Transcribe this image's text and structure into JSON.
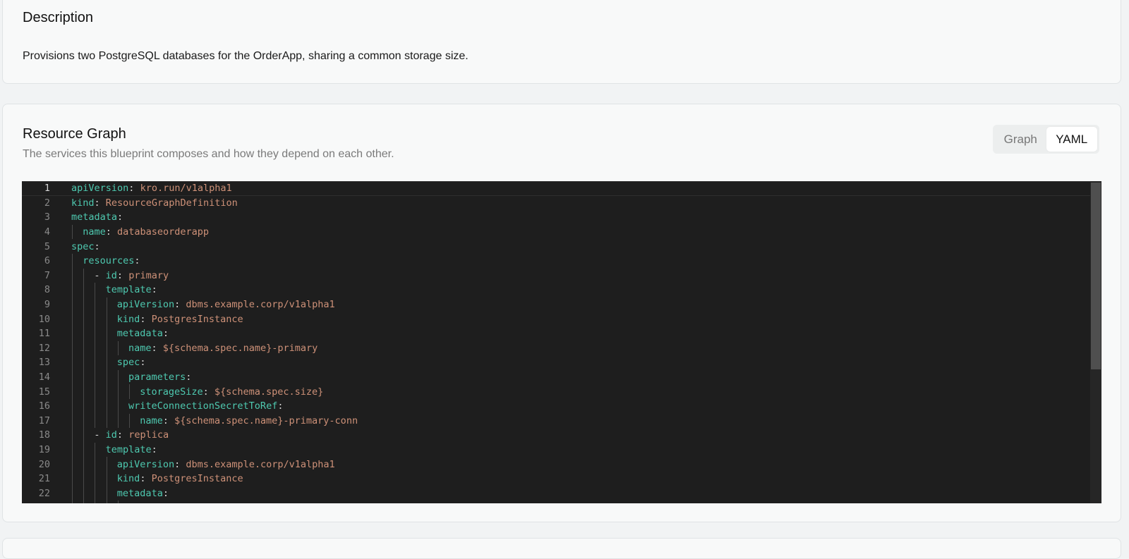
{
  "description": {
    "title": "Description",
    "text": "Provisions two PostgreSQL databases for the OrderApp, sharing a common storage size."
  },
  "resource_graph": {
    "title": "Resource Graph",
    "subtitle": "The services this blueprint composes and how they depend on each other.",
    "view_toggle": {
      "graph_label": "Graph",
      "yaml_label": "YAML",
      "active": "YAML"
    },
    "yaml_lines": [
      {
        "n": "1",
        "key": "apiVersion",
        "val": "kro.run/v1alpha1",
        "indent": 0
      },
      {
        "n": "2",
        "key": "kind",
        "val": "ResourceGraphDefinition",
        "indent": 0
      },
      {
        "n": "3",
        "key": "metadata",
        "val": "",
        "indent": 0
      },
      {
        "n": "4",
        "key": "name",
        "val": "databaseorderapp",
        "indent": 1
      },
      {
        "n": "5",
        "key": "spec",
        "val": "",
        "indent": 0
      },
      {
        "n": "6",
        "key": "resources",
        "val": "",
        "indent": 1
      },
      {
        "n": "7",
        "dash": "- ",
        "key": "id",
        "val": "primary",
        "indent": 2
      },
      {
        "n": "8",
        "key": "template",
        "val": "",
        "indent": 3
      },
      {
        "n": "9",
        "key": "apiVersion",
        "val": "dbms.example.corp/v1alpha1",
        "indent": 4
      },
      {
        "n": "10",
        "key": "kind",
        "val": "PostgresInstance",
        "indent": 4
      },
      {
        "n": "11",
        "key": "metadata",
        "val": "",
        "indent": 4
      },
      {
        "n": "12",
        "key": "name",
        "val": "${schema.spec.name}-primary",
        "indent": 5
      },
      {
        "n": "13",
        "key": "spec",
        "val": "",
        "indent": 4
      },
      {
        "n": "14",
        "key": "parameters",
        "val": "",
        "indent": 5
      },
      {
        "n": "15",
        "key": "storageSize",
        "val": "${schema.spec.size}",
        "indent": 6
      },
      {
        "n": "16",
        "key": "writeConnectionSecretToRef",
        "val": "",
        "indent": 5
      },
      {
        "n": "17",
        "key": "name",
        "val": "${schema.spec.name}-primary-conn",
        "indent": 6
      },
      {
        "n": "18",
        "dash": "- ",
        "key": "id",
        "val": "replica",
        "indent": 2
      },
      {
        "n": "19",
        "key": "template",
        "val": "",
        "indent": 3
      },
      {
        "n": "20",
        "key": "apiVersion",
        "val": "dbms.example.corp/v1alpha1",
        "indent": 4
      },
      {
        "n": "21",
        "key": "kind",
        "val": "PostgresInstance",
        "indent": 4
      },
      {
        "n": "22",
        "key": "metadata",
        "val": "",
        "indent": 4
      }
    ]
  }
}
